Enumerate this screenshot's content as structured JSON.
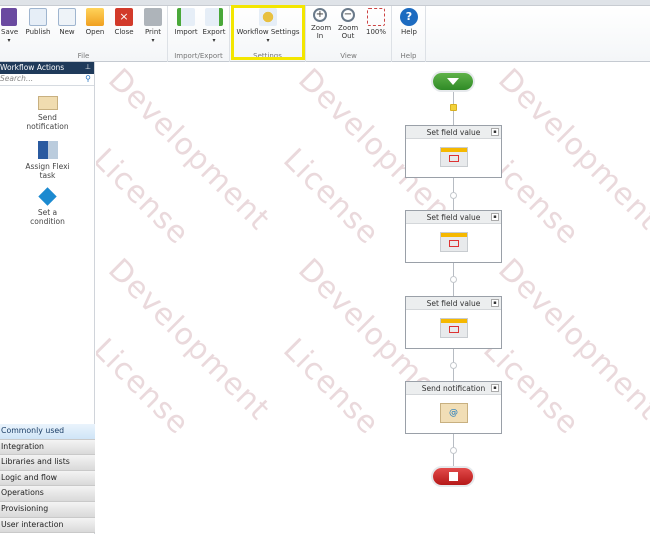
{
  "ribbon": {
    "groups": [
      {
        "label": "File",
        "buttons": [
          {
            "label": "Save",
            "dropdown": true
          },
          {
            "label": "Publish"
          },
          {
            "label": "New"
          },
          {
            "label": "Open"
          },
          {
            "label": "Close"
          },
          {
            "label": "Print",
            "dropdown": true
          }
        ]
      },
      {
        "label": "Import/Export",
        "buttons": [
          {
            "label": "Import"
          },
          {
            "label": "Export",
            "dropdown": true
          }
        ]
      },
      {
        "label": "Settings",
        "buttons": [
          {
            "label": "Workflow Settings",
            "dropdown": true
          }
        ]
      },
      {
        "label": "View",
        "buttons": [
          {
            "label": "Zoom In"
          },
          {
            "label": "Zoom Out"
          },
          {
            "label": "100%"
          }
        ]
      },
      {
        "label": "Help",
        "buttons": [
          {
            "label": "Help"
          }
        ]
      }
    ],
    "dropdown_glyph": "▾"
  },
  "sidebar": {
    "title": "Workflow Actions",
    "search_placeholder": "Search...",
    "actions": [
      {
        "label": "Send notification"
      },
      {
        "label": "Assign Flexi task"
      },
      {
        "label": "Set a condition"
      }
    ],
    "categories": [
      "Commonly used",
      "Integration",
      "Libraries and lists",
      "Logic and flow",
      "Operations",
      "Provisioning",
      "User interaction"
    ]
  },
  "canvas": {
    "watermark": [
      "Development",
      "License"
    ],
    "nodes": [
      {
        "title": "Set field value"
      },
      {
        "title": "Set field value"
      },
      {
        "title": "Set field value"
      },
      {
        "title": "Send notification"
      }
    ]
  },
  "colors": {
    "highlight": "#f3e600",
    "sidebar_header": "#1f3a5a",
    "start": "#3a9a2e",
    "end": "#c82020"
  }
}
